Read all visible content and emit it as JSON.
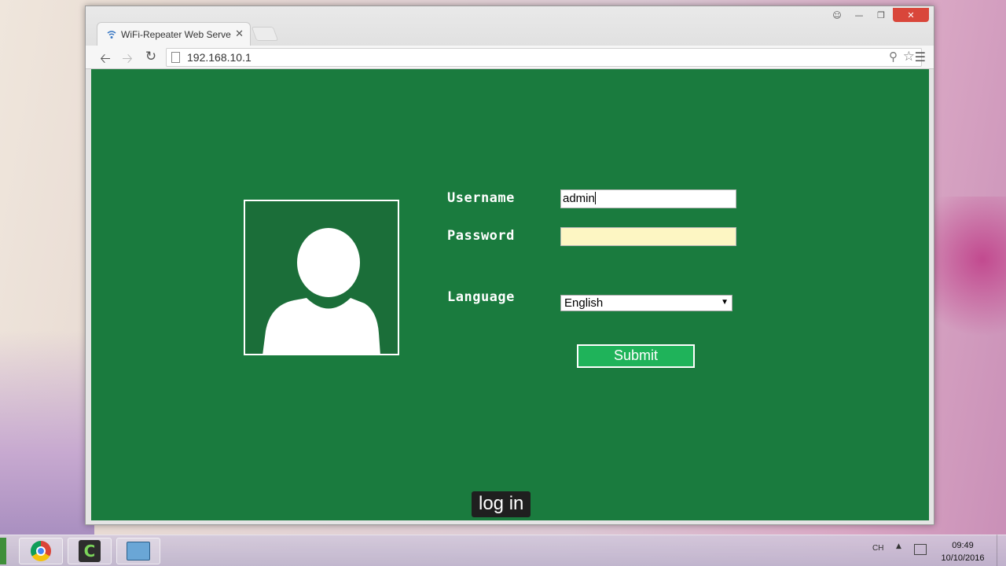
{
  "browser": {
    "tab_title": "WiFi-Repeater Web Server",
    "url": "192.168.10.1",
    "icons": {
      "tab_favicon": "wifi-icon",
      "back": "back-arrow-icon",
      "forward": "forward-arrow-icon",
      "reload": "reload-icon",
      "page": "page-icon",
      "key": "key-icon",
      "star": "star-icon",
      "menu": "hamburger-menu-icon"
    }
  },
  "login": {
    "username_label": "Username",
    "username_value": "admin",
    "password_label": "Password",
    "password_value": "",
    "language_label": "Language",
    "language_value": "English",
    "submit_label": "Submit"
  },
  "caption": "log in",
  "taskbar": {
    "input_language": "CH",
    "time": "09:49",
    "date": "10/10/2016"
  },
  "colors": {
    "page_background": "#1a7b3e",
    "avatar_background": "#1b6e39",
    "submit_background": "#1fb35a",
    "password_autofill": "#fdf6c3",
    "close_button": "#d9463a"
  }
}
